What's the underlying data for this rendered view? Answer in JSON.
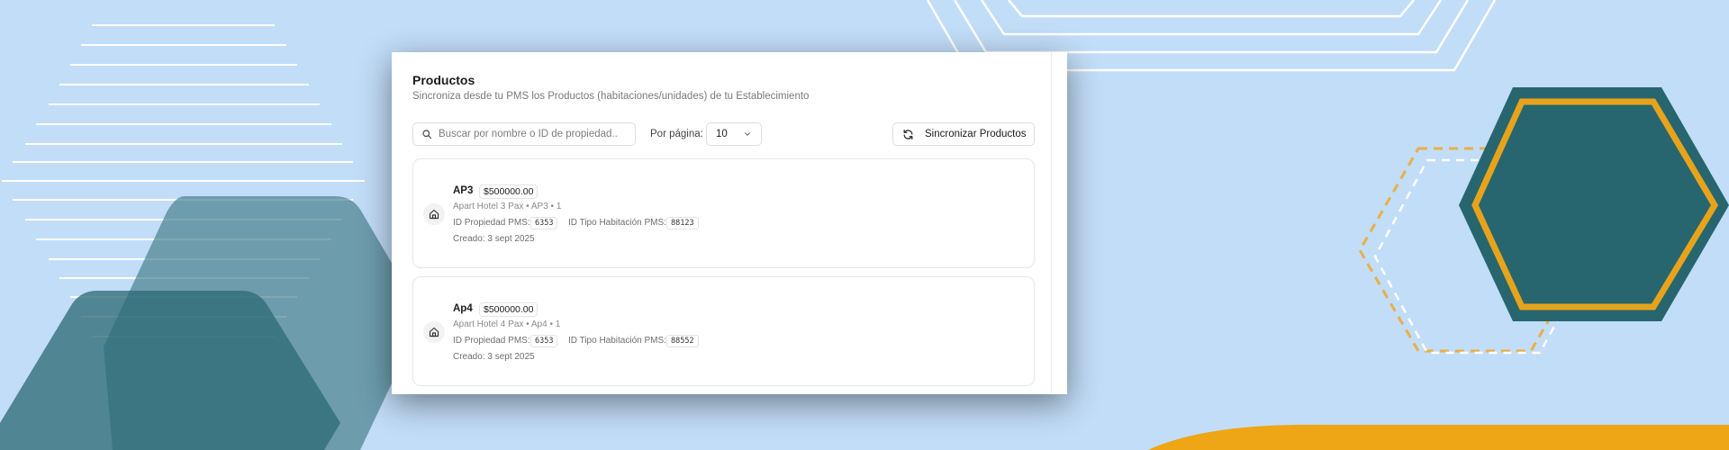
{
  "header": {
    "title": "Productos",
    "subtitle": "Sincroniza desde tu PMS los Productos (habitaciones/unidades) de tu Establecimiento"
  },
  "toolbar": {
    "search_placeholder": "Buscar por nombre o ID de propiedad...",
    "search_value": "",
    "per_page_label": "Por página:",
    "per_page_value": "10",
    "sync_label": "Sincronizar Productos"
  },
  "products": [
    {
      "name": "AP3",
      "price": "$500000.00",
      "description": "Apart Hotel 3 Pax • AP3 • 1",
      "property_label": "ID Propiedad PMS:",
      "property_id": "6353",
      "room_type_label": "ID Tipo Habitación PMS:",
      "room_type_id": "88123",
      "created": "Creado: 3 sept 2025"
    },
    {
      "name": "Ap4",
      "price": "$500000.00",
      "description": "Apart Hotel 4 Pax • Ap4 • 1",
      "property_label": "ID Propiedad PMS:",
      "property_id": "6353",
      "room_type_label": "ID Tipo Habitación PMS:",
      "room_type_id": "88552",
      "created": "Creado: 3 sept 2025"
    }
  ],
  "colors": {
    "background": "#c2ddf7",
    "teal": "#27666e",
    "gold": "#e8a31c"
  }
}
